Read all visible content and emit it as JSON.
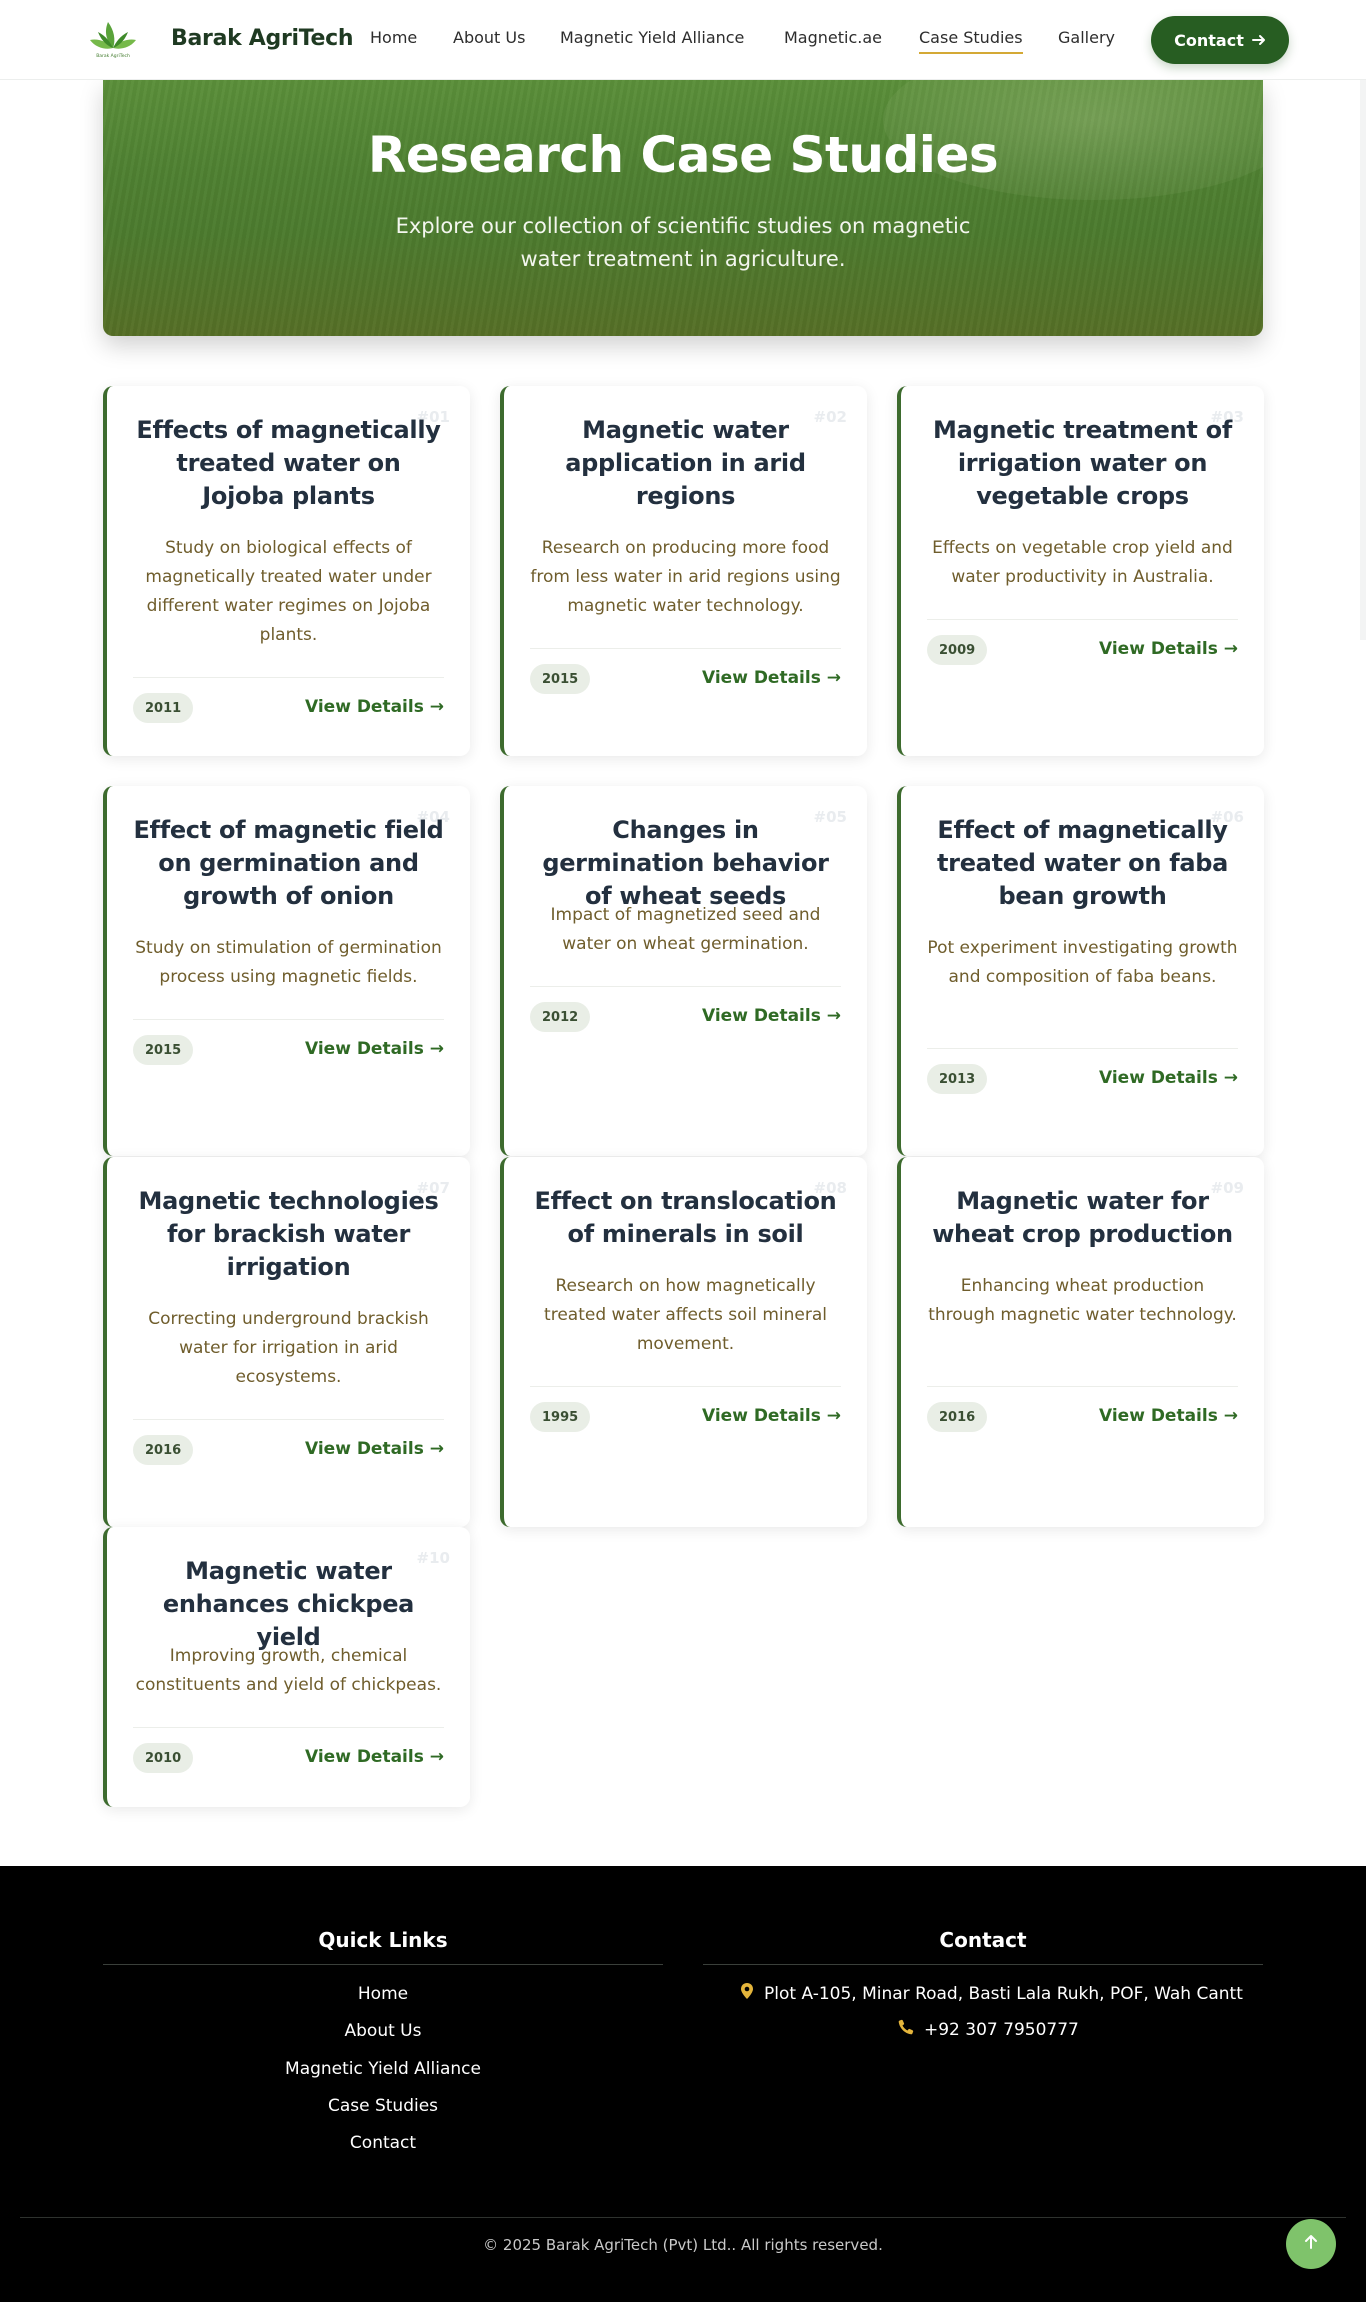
{
  "navbar": {
    "brand": "Barak AgriTech",
    "logo_text": "Barak AgriTech",
    "items": [
      {
        "label": "Home"
      },
      {
        "label": "About Us"
      },
      {
        "label": "Magnetic Yield Alliance"
      },
      {
        "label": "Magnetic.ae"
      },
      {
        "label": "Case Studies",
        "active": true
      },
      {
        "label": "Gallery"
      }
    ],
    "contact_label": "Contact"
  },
  "hero": {
    "title": "Research Case Studies",
    "subtitle": "Explore our collection of scientific studies on magnetic water treatment in agriculture."
  },
  "studies": [
    {
      "num": "#01",
      "title": "Effects of magnetically treated water on Jojoba plants",
      "desc": "Study on biological effects of magnetically treated water under different water regimes on Jojoba plants.",
      "year": "2011",
      "link": "View Details →"
    },
    {
      "num": "#02",
      "title": "Magnetic water application in arid regions",
      "desc": "Research on producing more food from less water in arid regions using magnetic water technology.",
      "year": "2015",
      "link": "View Details →"
    },
    {
      "num": "#03",
      "title": "Magnetic treatment of irrigation water on vegetable crops",
      "desc": "Effects on vegetable crop yield and water productivity in Australia.",
      "year": "2009",
      "link": "View Details →"
    },
    {
      "num": "#04",
      "title": "Effect of magnetic field on germination and growth of onion",
      "desc": "Study on stimulation of germination process using magnetic fields.",
      "year": "2015",
      "link": "View Details →"
    },
    {
      "num": "#05",
      "title": "Changes in germination behavior of wheat seeds",
      "desc": "Impact of magnetized seed and water on wheat germination.",
      "year": "2012",
      "link": "View Details →"
    },
    {
      "num": "#06",
      "title": "Effect of magnetically treated water on faba bean growth",
      "desc": "Pot experiment investigating growth and composition of faba beans.",
      "year": "2013",
      "link": "View Details →"
    },
    {
      "num": "#07",
      "title": "Magnetic technologies for brackish water irrigation",
      "desc": "Correcting underground brackish water for irrigation in arid ecosystems.",
      "year": "2016",
      "link": "View Details →"
    },
    {
      "num": "#08",
      "title": "Effect on translocation of minerals in soil",
      "desc": "Research on how magnetically treated water affects soil mineral movement.",
      "year": "1995",
      "link": "View Details →"
    },
    {
      "num": "#09",
      "title": "Magnetic water for wheat crop production",
      "desc": "Enhancing wheat production through magnetic water technology.",
      "year": "2016",
      "link": "View Details →"
    },
    {
      "num": "#10",
      "title": "Magnetic water enhances chickpea yield",
      "desc": "Improving growth, chemical constituents and yield of chickpeas.",
      "year": "2010",
      "link": "View Details →"
    }
  ],
  "footer": {
    "quick_links_heading": "Quick Links",
    "quick_links": [
      {
        "label": "Home"
      },
      {
        "label": "About Us"
      },
      {
        "label": "Magnetic Yield Alliance"
      },
      {
        "label": "Case Studies"
      },
      {
        "label": "Contact"
      }
    ],
    "contact_heading": "Contact",
    "address": "Plot A-105, Minar Road, Basti Lala Rukh, POF, Wah Cantt",
    "phone": "+92 307 7950777",
    "copyright": "© 2025 Barak AgriTech (Pvt) Ltd.. All rights reserved."
  },
  "colors": {
    "brand_green": "#275d22",
    "accent_gold": "#d4a935",
    "link_green": "#2f6a24",
    "desc_olive": "#6f5d2c",
    "scroll_button": "#7fc36b"
  },
  "icons": {
    "logo": "leaf-logo-icon",
    "contact_arrow": "arrow-right-icon",
    "address": "map-pin-icon",
    "phone": "phone-icon",
    "scroll_top": "arrow-up-icon"
  }
}
